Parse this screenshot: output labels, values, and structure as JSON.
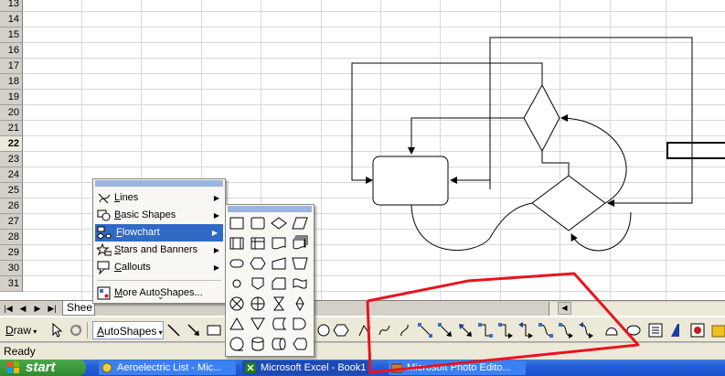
{
  "rows": {
    "labels": [
      "13",
      "14",
      "15",
      "16",
      "17",
      "18",
      "19",
      "20",
      "21",
      "22",
      "23",
      "24",
      "25",
      "26",
      "27",
      "28",
      "29",
      "30",
      "31"
    ],
    "active_row": "22"
  },
  "sheet_tabs": {
    "nav_buttons": [
      "|◀",
      "◀",
      "▶",
      "▶|"
    ],
    "active_tab": "Shee"
  },
  "drawing_toolbar": {
    "draw_label_prefix": "D",
    "draw_label_rest": "raw",
    "autoshapes_label_prefix": "A",
    "autoshapes_label_rest": "utoShapes"
  },
  "autoshapes_menu": {
    "items": [
      {
        "label_u": "L",
        "label_rest": "ines",
        "icon": "lines-icon",
        "has_submenu": true
      },
      {
        "label_u": "B",
        "label_rest": "asic Shapes",
        "icon": "basic-shapes-icon",
        "has_submenu": true
      },
      {
        "label_u": "F",
        "label_rest": "lowchart",
        "icon": "flowchart-icon",
        "has_submenu": true,
        "highlighted": true
      },
      {
        "label_u": "S",
        "label_rest": "tars and Banners",
        "icon": "stars-banners-icon",
        "has_submenu": true
      },
      {
        "label_u": "C",
        "label_rest": "allouts",
        "icon": "callouts-icon",
        "has_submenu": true
      }
    ],
    "more_label_u": "M",
    "more_label_rest": "ore AutoShapes...",
    "expand_glyph": "⌄"
  },
  "flowchart_submenu": {
    "shapes": [
      "process",
      "alternate-process",
      "decision",
      "data",
      "predefined-process",
      "internal-storage",
      "document",
      "multidocument",
      "terminator",
      "preparation",
      "manual-input",
      "manual-operation",
      "connector",
      "off-page-connector",
      "card",
      "punched-tape",
      "summing-junction",
      "or",
      "collate",
      "sort",
      "extract",
      "merge",
      "stored-data",
      "delay",
      "sequential-access-storage",
      "magnetic-disk",
      "direct-access-storage",
      "display"
    ]
  },
  "status_bar": {
    "text": "Ready"
  },
  "taskbar": {
    "start_label": "start",
    "buttons": [
      {
        "label": "Aeroelectric List - Mic...",
        "active": false
      },
      {
        "label": "Microsoft Excel - Book1",
        "active": true
      },
      {
        "label": "Microsoft Photo Edito...",
        "active": false
      }
    ]
  },
  "colors": {
    "annotation": "#e8141e",
    "menu_highlight": "#316ac5",
    "taskbar": "#245edb",
    "start_button": "#3c9a3c"
  }
}
